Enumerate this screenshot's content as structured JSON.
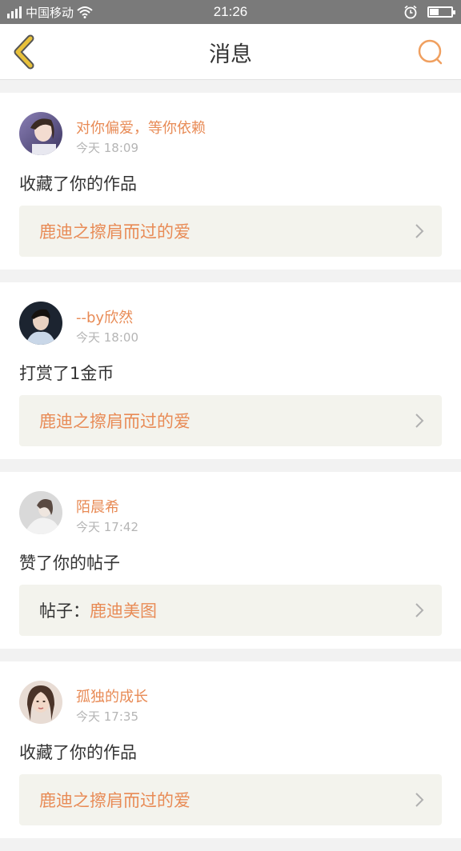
{
  "status_bar": {
    "carrier": "中国移动",
    "time": "21:26",
    "icons": [
      "signal-icon",
      "wifi-icon",
      "alarm-icon",
      "battery-icon"
    ],
    "battery_level": 0.4
  },
  "nav": {
    "title": "消息",
    "back_icon": "chevron-left-icon",
    "search_icon": "search-icon"
  },
  "colors": {
    "accent": "#e88b56",
    "back_arrow": "#e8c13a",
    "status_bar_bg": "#7a7a7a",
    "page_bg": "#f2f2f2",
    "target_bg": "#f3f3ed"
  },
  "notifications": [
    {
      "user": "对你偏爱，等你依赖",
      "time": "今天 18:09",
      "action": "收藏了你的作品",
      "target_prefix": "",
      "target_title": "鹿迪之擦肩而过的爱"
    },
    {
      "user": "--by欣然",
      "time": "今天 18:00",
      "action": "打赏了1金币",
      "target_prefix": "",
      "target_title": "鹿迪之擦肩而过的爱"
    },
    {
      "user": "陌晨希",
      "time": "今天 17:42",
      "action": "赞了你的帖子",
      "target_prefix": "帖子：",
      "target_title": "鹿迪美图"
    },
    {
      "user": "孤独的成长",
      "time": "今天 17:35",
      "action": "收藏了你的作品",
      "target_prefix": "",
      "target_title": "鹿迪之擦肩而过的爱"
    }
  ]
}
